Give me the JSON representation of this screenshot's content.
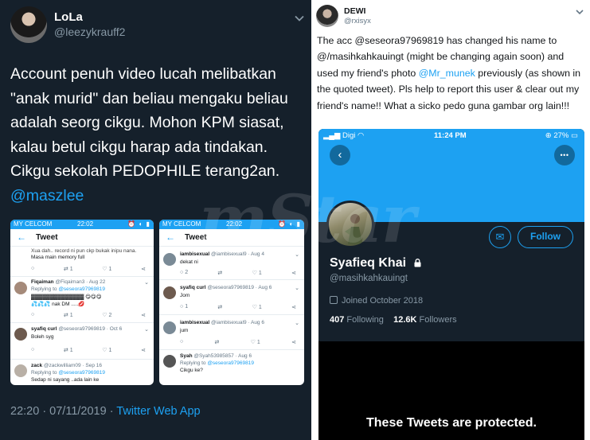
{
  "left_tweet": {
    "name": "LoLa",
    "handle": "@leezykrauff2",
    "text_before": "Account penuh video lucah melibatkan \"anak murid\" dan beliau mengaku beliau adalah seorg cikgu. Mohon KPM siasat, kalau betul cikgu harap ada tindakan. Cikgu sekolah PEDOPHILE terang2an.",
    "mention": "@maszlee",
    "timestamp": "22:20 · 07/11/2019 · ",
    "app": "Twitter Web App",
    "phone1": {
      "carrier": "MY CELCOM",
      "time": "22:02",
      "icons": "⏰ ◐ ▮",
      "title": "Tweet",
      "snippet_1": "Xua dah.. record ni pun ckp bukak inipu nana.",
      "snippet_2": "Masa main memory full",
      "acts_1": [
        "1",
        "1",
        "1"
      ],
      "reply1_name": "Fiqaiman",
      "reply1_meta": "@Fiqaiman3 · Aug 22",
      "reply1_to": "Replying to ",
      "reply1_mention": "@seseora97969819",
      "reply1_text_1": "▓▓▓▓▓▓▓▓▓▓▓▓▓▓ 😋😋😋",
      "reply1_text_2": "💦💦💦 nak DM .....💋",
      "acts_2": [
        "1",
        "2"
      ],
      "reply2_name": "syafiq curl",
      "reply2_meta": "@seseora97969819 · Oct 6",
      "reply2_text": "Boleh syg",
      "acts_3": [
        "1",
        "1"
      ],
      "reply3_name": "zack",
      "reply3_meta": "@zackwilliam09 · Sep 16",
      "reply3_to": "Replying to ",
      "reply3_mention": "@seseora97969819",
      "reply3_text": "Sedap ni sayang ..ada lain ke"
    },
    "phone2": {
      "carrier": "MY CELCOM",
      "time": "22:02",
      "icons": "⏰ ◐ ▮",
      "title": "Tweet",
      "r1_name": "iambisexual",
      "r1_meta": "@iambisexual9 · Aug 4",
      "r1_text": "dekat ni",
      "acts_1": [
        "2",
        "1"
      ],
      "r2_name": "syafiq curl",
      "r2_meta": "@seseora97969819 · Aug 6",
      "r2_text": "Jom",
      "acts_2": [
        "1",
        "1"
      ],
      "r3_name": "iambisexual",
      "r3_meta": "@iambisexual9 · Aug 6",
      "r3_text": "jum",
      "acts_3": [
        "1"
      ],
      "r4_name": "Syah",
      "r4_meta": "@Syah53985857 · Aug 6",
      "r4_to": "Replying to ",
      "r4_mention": "@seseora97969819",
      "r4_text": "Cikgu ke?"
    }
  },
  "right_tweet": {
    "name": "DEWI",
    "handle": "@rxisyx",
    "text_1": "The acc @seseora97969819 has changed his name to @/masihkahkauingt (might be changing again soon) and used my friend's photo ",
    "mention": "@Mr_munek",
    "text_2": " previously (as shown in the quoted tweet). Pls help to report this user & clear out my friend's name!! What a sicko pedo guna gambar org lain!!!",
    "phone": {
      "carrier": "Digi",
      "time": "11:24 PM",
      "battery": "27%",
      "back": "‹",
      "more": "•••",
      "mail_icon": "✉",
      "follow_label": "Follow",
      "profile_name": "Syafieq Khai",
      "profile_handle": "@masihkahkauingt",
      "joined": "Joined October 2018",
      "following_count": "407",
      "following_label": " Following",
      "followers_count": "12.6K",
      "followers_label": " Followers",
      "protected_text": "These Tweets are protected."
    }
  },
  "watermark": "mStar",
  "colors": {
    "dark_bg": "#15202b",
    "twitter_blue": "#1da1f2",
    "muted": "#8899a6"
  }
}
